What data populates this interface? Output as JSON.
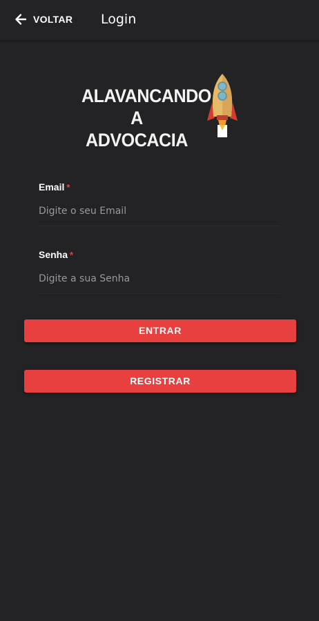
{
  "appbar": {
    "back_label": "VOLTAR",
    "back_icon": "arrow-left-icon",
    "title": "Login"
  },
  "logo": {
    "line1": "ALAVANCANDO",
    "line2": "A ADVOCACIA",
    "icon": "rocket-icon"
  },
  "form": {
    "email": {
      "label": "Email",
      "required": "*",
      "placeholder": "Digite o seu Email",
      "value": ""
    },
    "password": {
      "label": "Senha",
      "required": "*",
      "placeholder": "Digite a sua Senha",
      "value": ""
    }
  },
  "actions": {
    "login_label": "ENTRAR",
    "register_label": "REGISTRAR"
  },
  "colors": {
    "background": "#232326",
    "accent": "#e8403e",
    "placeholder": "#9a9a9e"
  }
}
